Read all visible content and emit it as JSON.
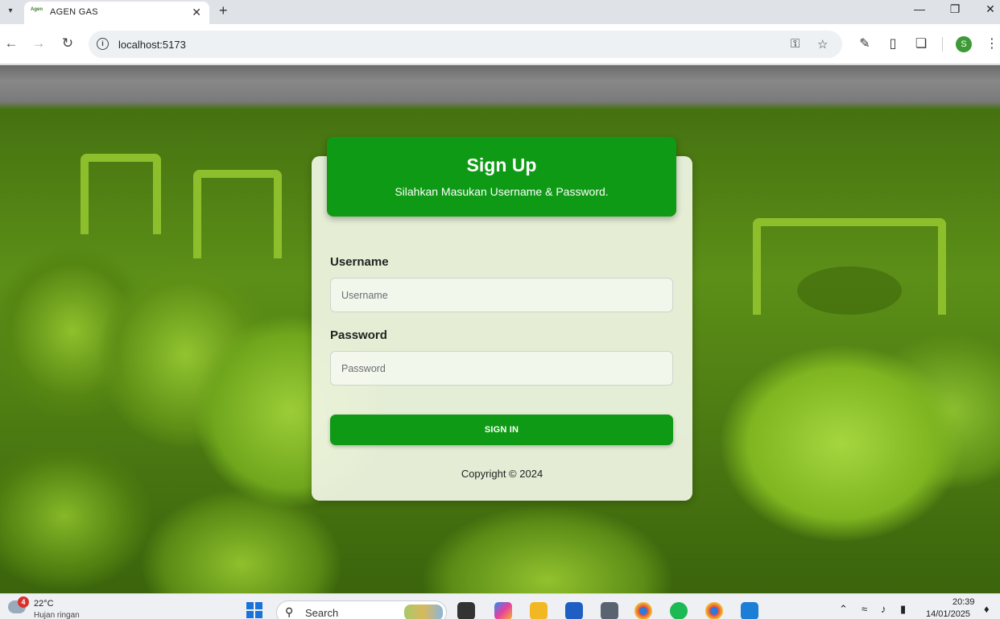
{
  "browser": {
    "tab_title": "AGEN GAS",
    "tab_favicon_text": "Agen",
    "url": "localhost:5173",
    "profile_initial": "S",
    "icons": {
      "tab_menu": "chevron-down-icon",
      "close_tab": "close-icon",
      "new_tab": "plus-icon",
      "minimize": "minimize-icon",
      "restore": "restore-icon",
      "close_window": "close-icon",
      "back": "back-arrow-icon",
      "forward": "forward-arrow-icon",
      "reload": "reload-icon",
      "site_info": "info-icon",
      "password_key": "key-icon",
      "bookmark": "star-icon",
      "eyedropper": "pen-icon",
      "reading_list": "side-panel-icon",
      "extensions": "puzzle-icon",
      "menu": "kebab-menu-icon"
    }
  },
  "page": {
    "background": "green LPG gas cylinders",
    "accent_color": "#0e9a14",
    "card": {
      "title": "Sign Up",
      "subtitle": "Silahkan Masukan Username & Password.",
      "username_label": "Username",
      "username_placeholder": "Username",
      "username_value": "",
      "password_label": "Password",
      "password_placeholder": "Password",
      "password_value": "",
      "submit_label": "SIGN IN",
      "copyright": "Copyright © 2024"
    }
  },
  "taskbar": {
    "weather_temp": "22°C",
    "weather_desc": "Hujan ringan",
    "weather_badge": "4",
    "search_label": "Search",
    "apps": [
      "file-explorer-icon",
      "copilot-icon",
      "folder-icon",
      "store-icon",
      "camera-icon",
      "chrome-icon",
      "spotify-icon",
      "chrome-profile-icon",
      "vscode-icon"
    ],
    "time": "20:39",
    "date": "14/01/2025"
  }
}
